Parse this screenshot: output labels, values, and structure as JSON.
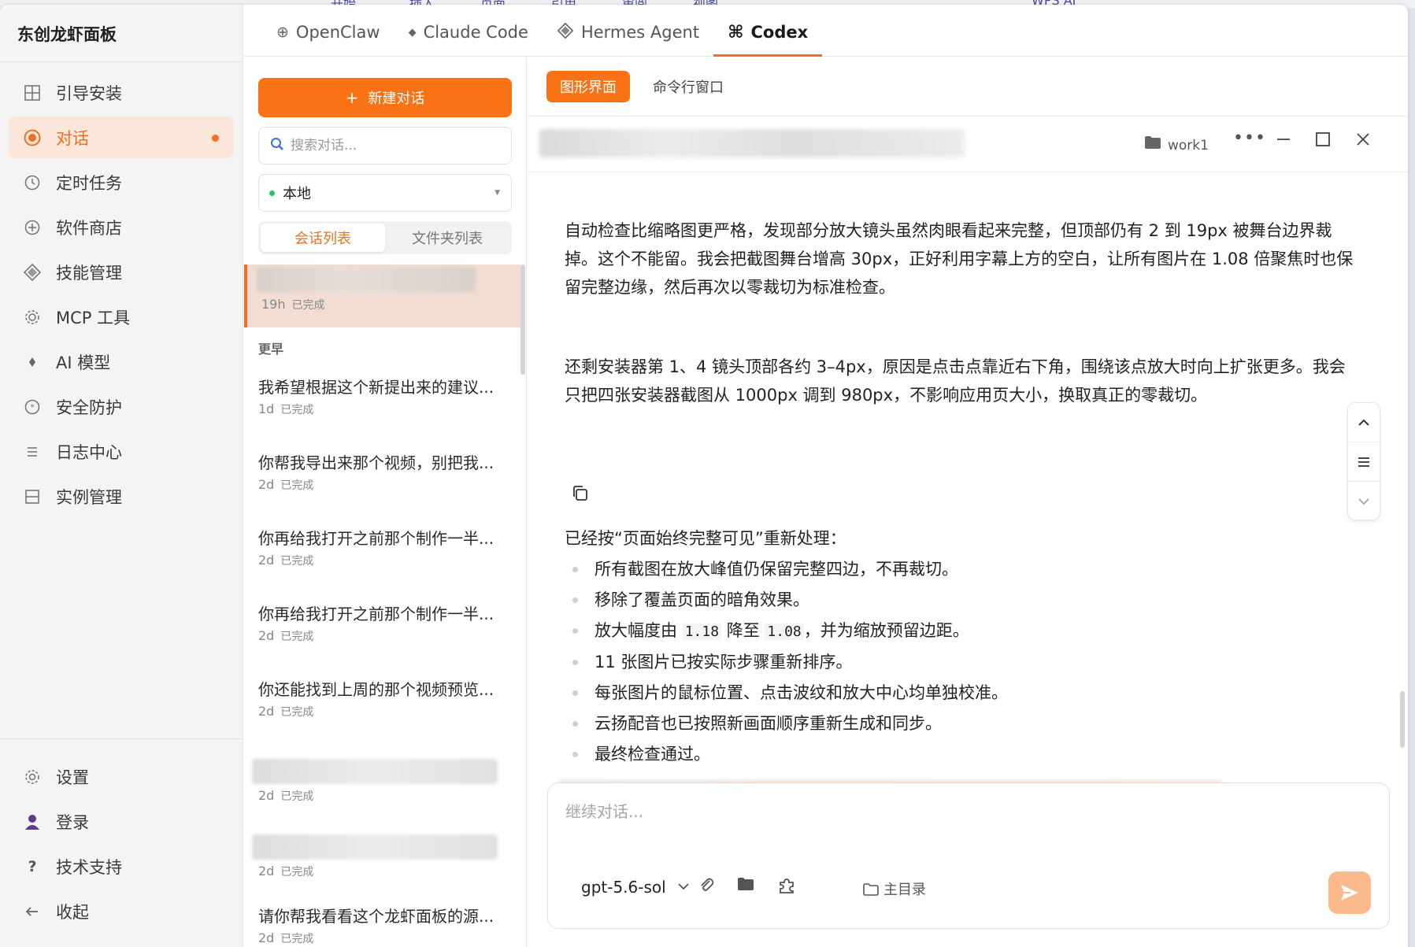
{
  "app": {
    "title": "东创龙虾面板"
  },
  "nav": {
    "items": [
      {
        "label": "引导安装",
        "icon": "grid-icon"
      },
      {
        "label": "对话",
        "icon": "chat-target-icon",
        "active": true
      },
      {
        "label": "定时任务",
        "icon": "clock-icon"
      },
      {
        "label": "软件商店",
        "icon": "store-icon"
      },
      {
        "label": "技能管理",
        "icon": "diamond-icon"
      },
      {
        "label": "MCP 工具",
        "icon": "gear-icon"
      },
      {
        "label": "AI 模型",
        "icon": "sparkle-icon"
      },
      {
        "label": "安全防护",
        "icon": "shield-icon"
      },
      {
        "label": "日志中心",
        "icon": "list-icon"
      },
      {
        "label": "实例管理",
        "icon": "instance-icon"
      }
    ],
    "bottom": [
      {
        "label": "设置",
        "icon": "settings-icon"
      },
      {
        "label": "登录",
        "icon": "user-icon"
      },
      {
        "label": "技术支持",
        "icon": "help-icon"
      },
      {
        "label": "收起",
        "icon": "collapse-icon"
      }
    ]
  },
  "tabs": [
    {
      "label": "OpenClaw",
      "icon": "globe-icon"
    },
    {
      "label": "Claude Code",
      "icon": "diamond-small-icon"
    },
    {
      "label": "Hermes Agent",
      "icon": "diamond-icon"
    },
    {
      "label": "Codex",
      "icon": "command-icon",
      "active": true
    }
  ],
  "sidebar": {
    "new_chat": "新建对话",
    "search_placeholder": "搜索对话...",
    "env": "本地",
    "seg": [
      "会话列表",
      "文件夹列表"
    ],
    "active_item": {
      "time": "19h",
      "status": "已完成"
    },
    "group_label": "更早",
    "items": [
      {
        "title": "我希望根据这个新提出来的建议...",
        "time": "1d",
        "status": "已完成"
      },
      {
        "title": "你帮我导出来那个视频，别把我...",
        "time": "2d",
        "status": "已完成"
      },
      {
        "title": "你再给我打开之前那个制作一半...",
        "time": "2d",
        "status": "已完成"
      },
      {
        "title": "你再给我打开之前那个制作一半...",
        "time": "2d",
        "status": "已完成"
      },
      {
        "title": "你还能找到上周的那个视频预览...",
        "time": "2d",
        "status": "已完成"
      },
      {
        "title": "",
        "time": "2d",
        "status": "已完成",
        "blurred": true
      },
      {
        "title": "",
        "time": "2d",
        "status": "已完成",
        "blurred": true
      },
      {
        "title": "请你帮我看看这个龙虾面板的源...",
        "time": "2d",
        "status": "已完成"
      }
    ]
  },
  "main": {
    "modes": [
      "图形界面",
      "命令行窗口"
    ],
    "folder": "work1",
    "para1": "自动检查比缩略图更严格，发现部分放大镜头虽然肉眼看起来完整，但顶部仍有 2 到 19px 被舞台边界裁掉。这个不能留。我会把截图舞台增高 30px，正好利用字幕上方的空白，让所有图片在 1.08 倍聚焦时也保留完整边缘，然后再次以零裁切为标准检查。",
    "para2": "还剩安装器第 1、4 镜头顶部各约 3–4px，原因是点击点靠近右下角，围绕该点放大时向上扩张更多。我会只把四张安装器截图从 1000px 调到 980px，不影响应用页大小，换取真正的零裁切。",
    "para3": "已经按“页面始终完整可见”重新处理：",
    "bullets": [
      "所有截图在放大峰值仍保留完整四边，不再裁切。",
      "移除了覆盖页面的暗角效果。",
      "11 张图片已按实际步骤重新排序。",
      "每张图片的鼠标位置、点击波纹和放大中心均单独校准。",
      "云扬配音也已按照新画面顺序重新生成和同步。",
      "最终检查通过。"
    ],
    "bullet3": {
      "pre": "放大幅度由 ",
      "a": "1.18",
      "mid": " 降至 ",
      "b": "1.08",
      "post": "，并为缩放预留边距。"
    }
  },
  "composer": {
    "placeholder": "继续对话...",
    "model": "gpt-5.6-sol",
    "homedir": "主目录"
  },
  "colors": {
    "accent": "#f97316",
    "active_bg": "#fbe7da"
  }
}
